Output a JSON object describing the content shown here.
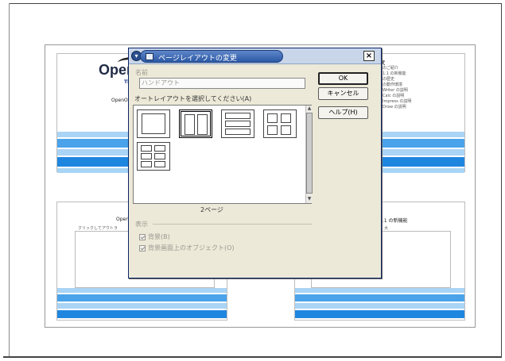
{
  "background_slides": {
    "top_left": {
      "logo_text": "Oper",
      "tagline": "The D",
      "caption": "OpenOf"
    },
    "top_right": {
      "heading": "次",
      "lines": [
        "のご紹介",
        "1.1 の新機能",
        "の歴史",
        "の動作環境",
        "Writer の説明",
        "Calc の説明",
        "Impress の説明",
        "Draw の説明"
      ]
    },
    "bottom_left": {
      "title": "OpenO",
      "placeholder": "クリックしてアウトラ"
    },
    "bottom_right": {
      "title": "1.1 の新機能",
      "sub": "大"
    }
  },
  "dialog": {
    "title": "ページレイアウトの変更",
    "close_glyph": "×",
    "name_label": "名前",
    "name_value": "ハンドアウト",
    "select_label": "オートレイアウトを選択してください(A)",
    "buttons": {
      "ok": "OK",
      "cancel": "キャンセル",
      "help": "ヘルプ(H)"
    },
    "selected_caption": "2ページ",
    "display_label": "表示",
    "options": {
      "background": "背景(B)",
      "objects": "背景画面上のオブジェクト(O)"
    }
  },
  "colors": {
    "stripe_light": "#a9d4f5",
    "stripe_mid": "#4aa3ea",
    "stripe_dark": "#1f86e0",
    "dialog_bg": "#ece9d8",
    "title_pill": "#2c59a6"
  }
}
